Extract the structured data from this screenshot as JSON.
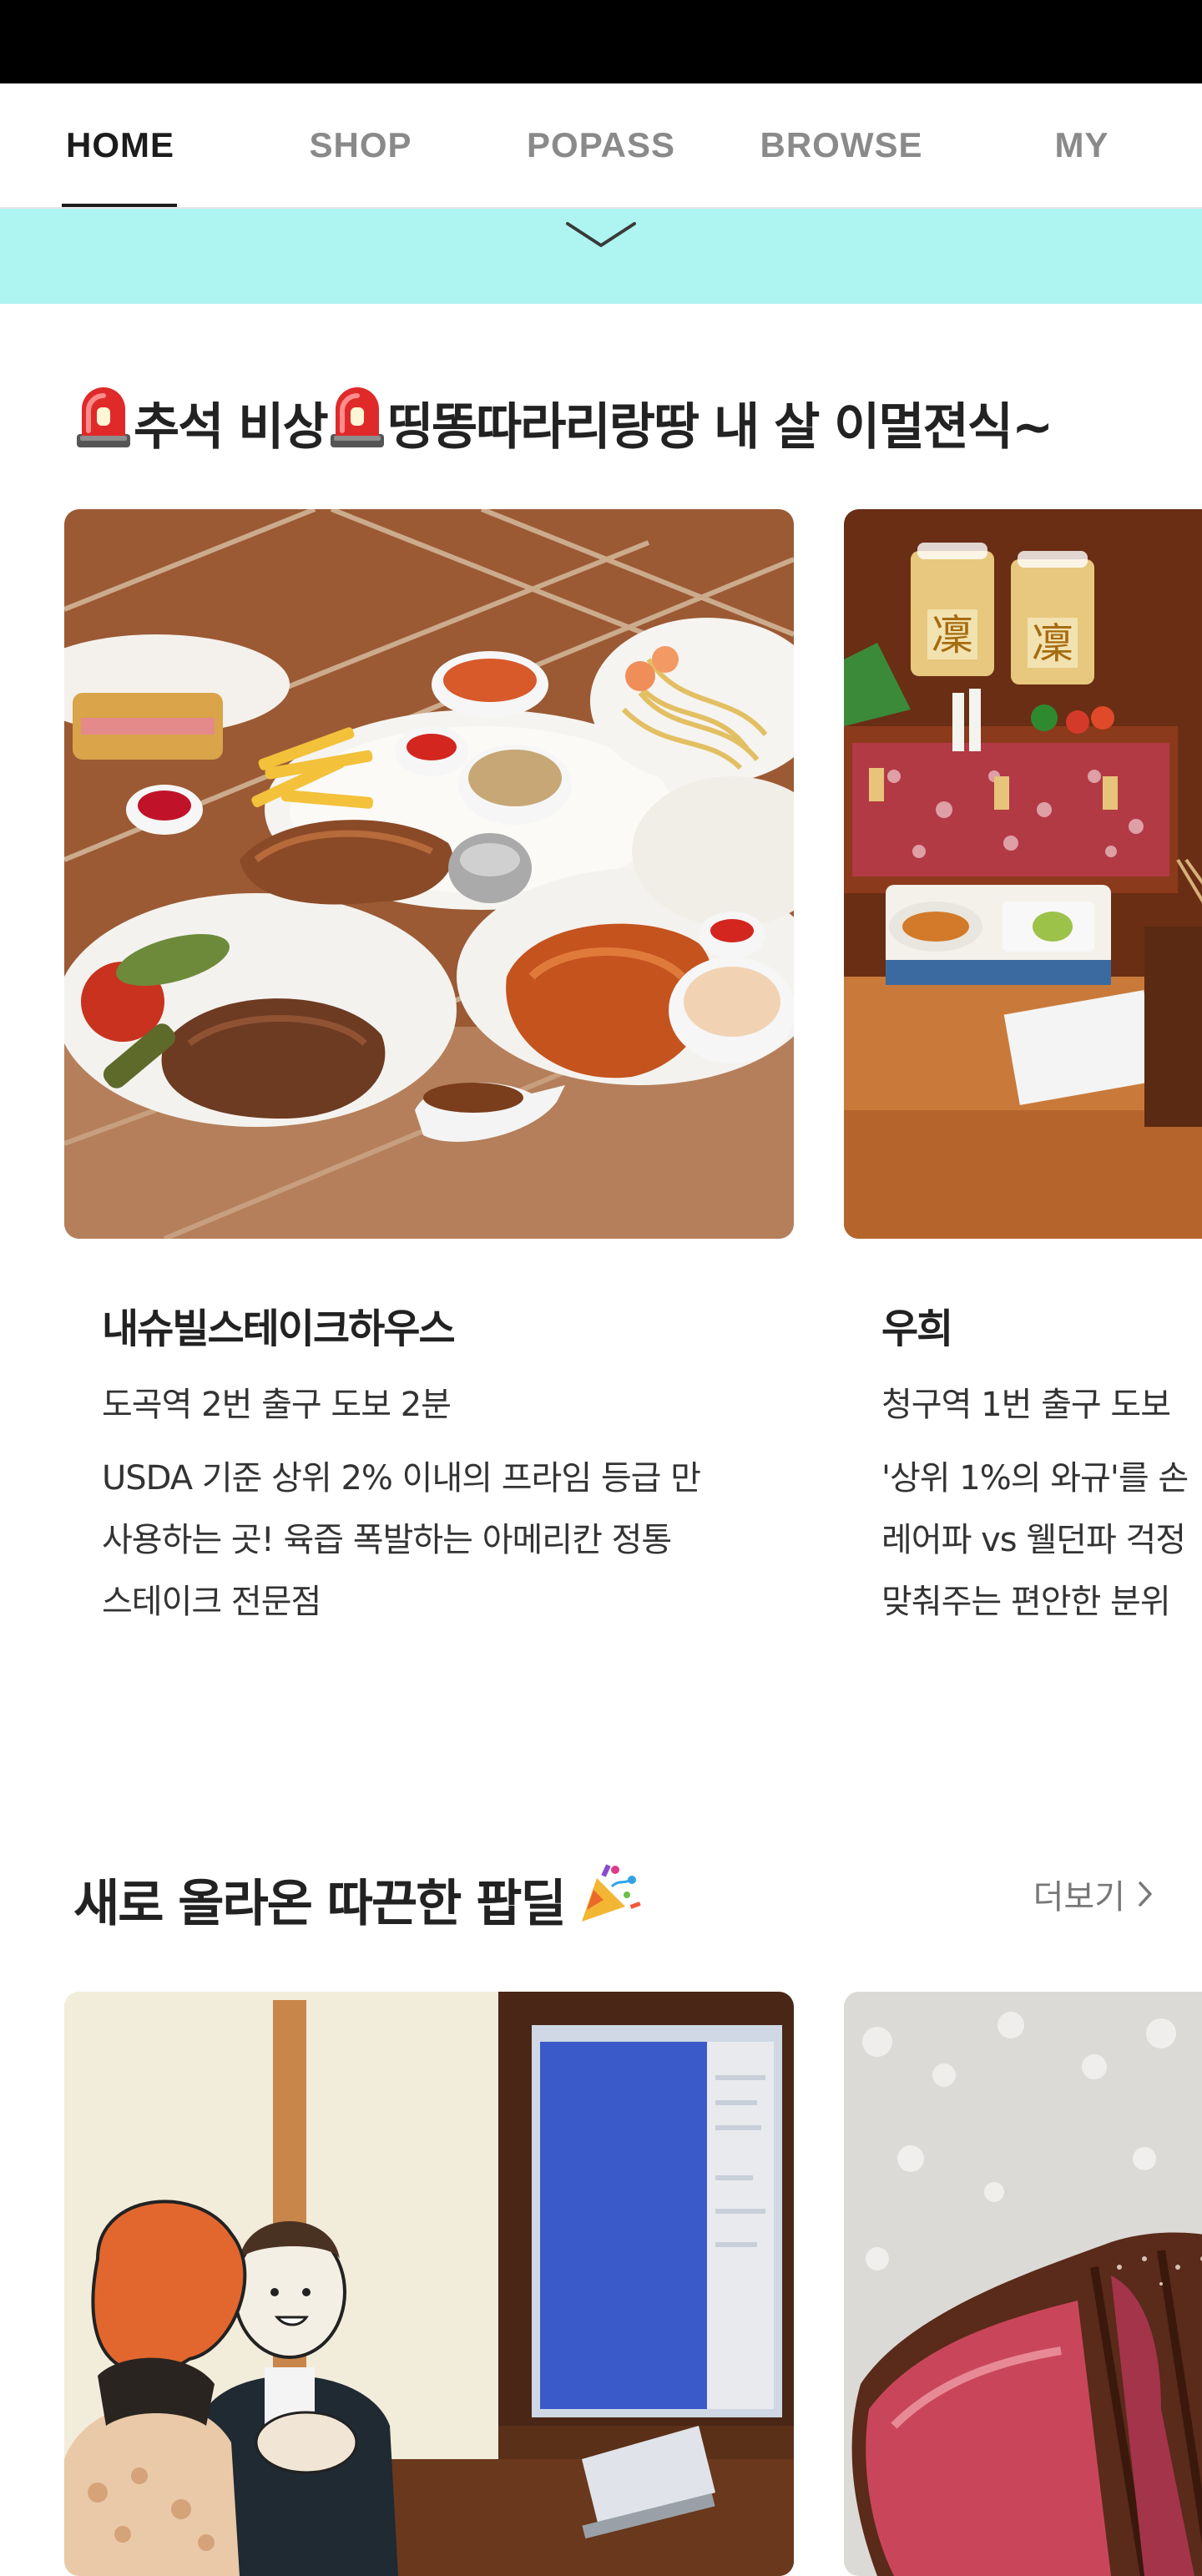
{
  "tabs": [
    {
      "label": "HOME",
      "active": true
    },
    {
      "label": "SHOP",
      "active": false
    },
    {
      "label": "POPASS",
      "active": false
    },
    {
      "label": "BROWSE",
      "active": false
    },
    {
      "label": "MY",
      "active": false
    }
  ],
  "banner": {
    "color": "#aef5f1",
    "icon": "chevron-down-icon"
  },
  "section1": {
    "title_part1": "추석 비상",
    "title_part2": " 띵똥따라리랑땅 내 살 이멀젼식~",
    "title_icon": "siren-emoji-icon",
    "cards": [
      {
        "name": "내슈빌스테이크하우스",
        "location": "도곡역 2번 출구 도보 2분",
        "description": "USDA 기준 상위 2% 이내의 프라임 등급 만\n사용하는 곳! 육즙 폭발하는 아메리칸 정통\n스테이크 전문점",
        "image": "steak-platter-photo"
      },
      {
        "name": "우희",
        "location": "청구역 1번 출구 도보",
        "description": "'상위 1%의 와규'를 손\n레어파 vs 웰던파 걱정\n맞춰주는 편안한 분위",
        "image": "wagyu-tray-photo"
      }
    ]
  },
  "section2": {
    "title": "새로 올라온 따끈한 팝딜",
    "title_icon": "party-popper-icon",
    "more_label": "더보기",
    "cards": [
      {
        "image": "office-meeting-illustration-photo"
      },
      {
        "image": "sliced-steak-photo"
      }
    ]
  }
}
